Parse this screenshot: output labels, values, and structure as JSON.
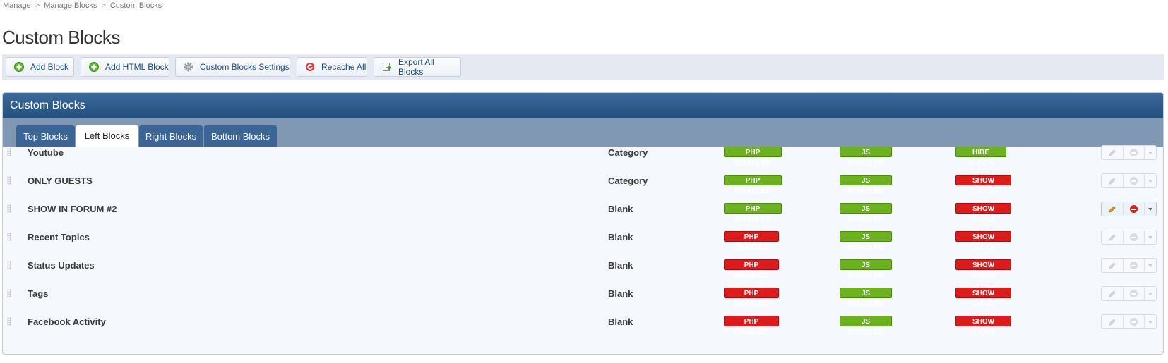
{
  "breadcrumb": [
    "Manage",
    "Manage Blocks",
    "Custom Blocks"
  ],
  "page_title": "Custom Blocks",
  "toolbar": {
    "add_block": "Add Block",
    "add_html_block": "Add HTML Block",
    "settings": "Custom Blocks Settings",
    "recache": "Recache All",
    "export": "Export All Blocks"
  },
  "panel": {
    "title": "Custom Blocks",
    "tabs": [
      "Top Blocks",
      "Left Blocks",
      "Right Blocks",
      "Bottom Blocks"
    ],
    "active_tab": "Left Blocks"
  },
  "rows": [
    {
      "title": "Youtube",
      "type": "Category",
      "php": "PHP DISABLED",
      "js": "JS DISABLED",
      "visibility": "HIDE BLOCK"
    },
    {
      "title": "ONLY GUESTS",
      "type": "Category",
      "php": "PHP DISABLED",
      "js": "JS DISABLED",
      "visibility": "SHOW BLOCK"
    },
    {
      "title": "SHOW IN FORUM #2",
      "type": "Blank",
      "php": "PHP DISABLED",
      "js": "JS DISABLED",
      "visibility": "SHOW BLOCK"
    },
    {
      "title": "Recent Topics",
      "type": "Blank",
      "php": "PHP ENABLED",
      "js": "JS DISABLED",
      "visibility": "SHOW BLOCK"
    },
    {
      "title": "Status Updates",
      "type": "Blank",
      "php": "PHP ENABLED",
      "js": "JS DISABLED",
      "visibility": "SHOW BLOCK"
    },
    {
      "title": "Tags",
      "type": "Blank",
      "php": "PHP ENABLED",
      "js": "JS DISABLED",
      "visibility": "SHOW BLOCK"
    },
    {
      "title": "Facebook Activity",
      "type": "Blank",
      "php": "PHP ENABLED",
      "js": "JS DISABLED",
      "visibility": "SHOW BLOCK"
    }
  ],
  "colors": {
    "header_blue": "#2b5785",
    "tab_bar": "#8198b5",
    "badge_green": "#6cb21e",
    "badge_red": "#dd1b1b"
  }
}
